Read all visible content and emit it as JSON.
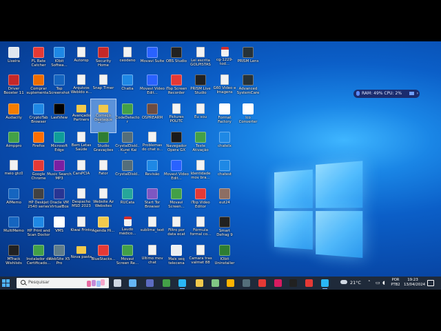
{
  "desktop": {
    "icons": [
      {
        "label": "Lixeira",
        "kind": "bin",
        "color": "#dfe7ef"
      },
      {
        "label": "FL Rate Catcher",
        "kind": "app",
        "color": "#e53935"
      },
      {
        "label": "IObit Softwa...",
        "kind": "app",
        "color": "#1e88e5"
      },
      {
        "label": "Autorop",
        "kind": "file",
        "color": "#f3f3f3"
      },
      {
        "label": "Security Home",
        "kind": "app",
        "color": "#c62828"
      },
      {
        "label": "ceodeno",
        "kind": "file",
        "color": "#f3f3f3"
      },
      {
        "label": "Movavi Suite",
        "kind": "app",
        "color": "#2962ff"
      },
      {
        "label": "OBS Studio",
        "kind": "app",
        "color": "#212121"
      },
      {
        "label": "Lei escrita GOLPISTAS",
        "kind": "file",
        "color": "#f3f3f3"
      },
      {
        "label": "cg-1229-tod...",
        "kind": "pdf",
        "color": "#d32f2f"
      },
      {
        "label": "PRISM Lens",
        "kind": "app",
        "color": "#263238"
      },
      {
        "label": "Driver Booster 11",
        "kind": "app",
        "color": "#c62828"
      },
      {
        "label": "Comprar suplementa...",
        "kind": "app",
        "color": "#ef6c00"
      },
      {
        "label": "Top Screenshot",
        "kind": "app",
        "color": "#1565c0"
      },
      {
        "label": "Arquivos Webldo e...",
        "kind": "file",
        "color": "#f3f3f3"
      },
      {
        "label": "Snap Timer",
        "kind": "file",
        "color": "#f3f3f3"
      },
      {
        "label": "Chatia",
        "kind": "app",
        "color": "#1e88e5"
      },
      {
        "label": "Movavi Video Edit...",
        "kind": "app",
        "color": "#2962ff"
      },
      {
        "label": "iTop Screen Recorder",
        "kind": "app",
        "color": "#e53935"
      },
      {
        "label": "PRISM Live Studio",
        "kind": "app",
        "color": "#212121"
      },
      {
        "label": "G60 Video e Imagens",
        "kind": "file",
        "color": "#f3f3f3"
      },
      {
        "label": "Advanced SystemCare",
        "kind": "app",
        "color": "#263238"
      },
      {
        "label": "Audacity",
        "kind": "app",
        "color": "#f57c00"
      },
      {
        "label": "CryptoTab Browser",
        "kind": "app",
        "color": "#1e88e5"
      },
      {
        "label": "LastView",
        "kind": "app",
        "color": "#000000"
      },
      {
        "label": "Avançado Partners",
        "kind": "folder",
        "color": "#f2c94c"
      },
      {
        "label": "Começo Destaque Ban...",
        "kind": "folder",
        "color": "#f2c94c"
      },
      {
        "label": "CodeDetector",
        "kind": "app",
        "color": "#43a047"
      },
      {
        "label": "OSPREARM",
        "kind": "app",
        "color": "#6d4c41"
      },
      {
        "label": "Pictures POLITC",
        "kind": "file",
        "color": "#f3f3f3"
      },
      {
        "label": "Eu sou",
        "kind": "file",
        "color": "#f3f3f3"
      },
      {
        "label": "Format Factory",
        "kind": "app",
        "color": "#ffffff"
      },
      {
        "label": "Ico Converter",
        "kind": "app",
        "color": "#ffffff"
      },
      {
        "label": "Aimppro",
        "kind": "app",
        "color": "#43a047"
      },
      {
        "label": "Firefox",
        "kind": "app",
        "color": "#ff6d00"
      },
      {
        "label": "Microsoft Edge",
        "kind": "app",
        "color": "#0f9d9a"
      },
      {
        "label": "Bem Letas Saúde",
        "kind": "file",
        "color": "#f3f3f3"
      },
      {
        "label": "Studio Gravações",
        "kind": "app",
        "color": "#2e7d32"
      },
      {
        "label": "CrystalDiskI... Kurei Kai E...",
        "kind": "app",
        "color": "#546e7a"
      },
      {
        "label": "Problemas do chat o...",
        "kind": "file",
        "color": "#f3f3f3"
      },
      {
        "label": "Navegador Opera GX",
        "kind": "app",
        "color": "#1a1a1a"
      },
      {
        "label": "Teste Ativação",
        "kind": "app",
        "color": "#43a047"
      },
      {
        "label": "chatelx",
        "kind": "app",
        "color": "#1e88e5"
      },
      {
        "label": "meio gtc0",
        "kind": "file",
        "color": "#f3f3f3"
      },
      {
        "label": "Google Chrome",
        "kind": "app",
        "color": "#e53935"
      },
      {
        "label": "Music Search MP3",
        "kind": "app",
        "color": "#7b1fa2"
      },
      {
        "label": "CarsPCIA",
        "kind": "file",
        "color": "#f3f3f3"
      },
      {
        "label": "Fator",
        "kind": "file",
        "color": "#f3f3f3"
      },
      {
        "label": "CrystalDiskI...",
        "kind": "app",
        "color": "#546e7a"
      },
      {
        "label": "Revisão",
        "kind": "app",
        "color": "#1e88e5"
      },
      {
        "label": "Movavi Video Edit...",
        "kind": "app",
        "color": "#2962ff"
      },
      {
        "label": "Identidade mov bra...",
        "kind": "file",
        "color": "#f3f3f3"
      },
      {
        "label": "chatest",
        "kind": "app",
        "color": "#1e88e5"
      },
      {
        "label": "AIMemo",
        "kind": "app",
        "color": "#1565c0"
      },
      {
        "label": "HP Deskjet 2540 series",
        "kind": "app",
        "color": "#424242"
      },
      {
        "label": "Oracle VM VirtualBox",
        "kind": "app",
        "color": "#283593"
      },
      {
        "label": "Despacho MSD 2023",
        "kind": "file",
        "color": "#f3f3f3"
      },
      {
        "label": "Website Az Websites",
        "kind": "file",
        "color": "#f3f3f3"
      },
      {
        "label": "RUCata",
        "kind": "app",
        "color": "#26a69a"
      },
      {
        "label": "Start Tor Browser",
        "kind": "app",
        "color": "#7e57c2"
      },
      {
        "label": "Movavi Screen...",
        "kind": "app",
        "color": "#43a047"
      },
      {
        "label": "iTop Video Editor",
        "kind": "app",
        "color": "#e53935"
      },
      {
        "label": "eut24",
        "kind": "app",
        "color": "#8d6e63"
      },
      {
        "label": "MultiMemo",
        "kind": "app",
        "color": "#1565c0"
      },
      {
        "label": "HP Print and Scan Doctor",
        "kind": "app",
        "color": "#1e88e5"
      },
      {
        "label": "VMS",
        "kind": "app",
        "color": "#ffffff"
      },
      {
        "label": "Kiwai Frinto",
        "kind": "file",
        "color": "#f3f3f3"
      },
      {
        "label": "Agenda Hi...",
        "kind": "app",
        "color": "#f2c94c"
      },
      {
        "label": "Laudo médico...",
        "kind": "pdf",
        "color": "#d32f2f"
      },
      {
        "label": "sublime_text",
        "kind": "file",
        "color": "#f3f3f3"
      },
      {
        "label": "Filtro por data ecat",
        "kind": "file",
        "color": "#f3f3f3"
      },
      {
        "label": "Fórmula formal co...",
        "kind": "file",
        "color": "#f3f3f3"
      },
      {
        "label": "Smart Defrag 9",
        "kind": "app",
        "color": "#212121"
      },
      {
        "label": "MTrack Wishlists",
        "kind": "app",
        "color": "#212121"
      },
      {
        "label": "Instalador de Certificado...",
        "kind": "app",
        "color": "#43a047"
      },
      {
        "label": "WebSite X5 Pro",
        "kind": "app",
        "color": "#607d8b"
      },
      {
        "label": "Nova pasta",
        "kind": "folder",
        "color": "#f2c94c"
      },
      {
        "label": "BlueStacks...",
        "kind": "app",
        "color": "#e53935"
      },
      {
        "label": "Movavi Screen Re...",
        "kind": "app",
        "color": "#43a047"
      },
      {
        "label": "Ultimo mov chat",
        "kind": "file",
        "color": "#f3f3f3"
      },
      {
        "label": "Mais seq telecena",
        "kind": "app",
        "color": "#eceff1"
      },
      {
        "label": "Camara tras valmet 88",
        "kind": "file",
        "color": "#f3f3f3"
      },
      {
        "label": "IObit Uninstaller",
        "kind": "app",
        "color": "#2e7d32"
      }
    ]
  },
  "overlay": {
    "text": "RAM: 49%  CPU: 2%"
  },
  "taskbar": {
    "search_placeholder": "Pesquisar",
    "apps": [
      {
        "name": "task-view-icon",
        "color": "#cfd8e3"
      },
      {
        "name": "file-explorer-icon",
        "color": "#64b5f6"
      },
      {
        "name": "chat-icon",
        "color": "#5c6bc0"
      },
      {
        "name": "clock-app-icon",
        "color": "#43a047"
      },
      {
        "name": "edge-icon",
        "color": "#29b6f6"
      },
      {
        "name": "folder-icon",
        "color": "#f2c94c"
      },
      {
        "name": "photos-icon",
        "color": "#81c784"
      },
      {
        "name": "store-icon",
        "color": "#ffb300"
      },
      {
        "name": "calendar-icon",
        "color": "#546e7a"
      },
      {
        "name": "media-icon",
        "color": "#e53935"
      },
      {
        "name": "opera-icon",
        "color": "#d81b60"
      },
      {
        "name": "tiktok-icon",
        "color": "#212121"
      },
      {
        "name": "obs-icon",
        "color": "#e53935"
      },
      {
        "name": "chrome-icon",
        "color": "#29b6f6"
      },
      {
        "name": "record-icon",
        "color": "#e53935"
      }
    ],
    "weather": "21°C",
    "language": "POR\nPTB2",
    "time": "19:23",
    "date": "13/04/2024"
  }
}
